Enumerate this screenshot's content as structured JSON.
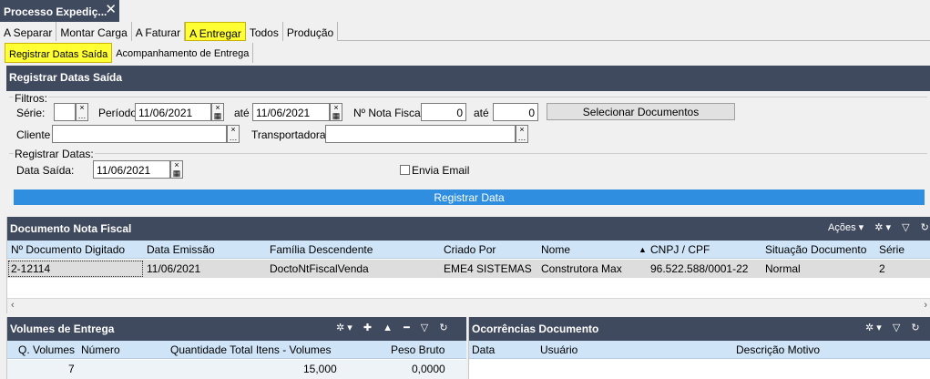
{
  "window": {
    "title": "Processo Expediç...",
    "close": "✕"
  },
  "tabs_main": [
    {
      "label": "A Separar"
    },
    {
      "label": "Montar Carga"
    },
    {
      "label": "A Faturar"
    },
    {
      "label": "A Entregar"
    },
    {
      "label": "Todos"
    },
    {
      "label": "Produção"
    }
  ],
  "tabs_sub": [
    {
      "label": "Registrar Datas Saída"
    },
    {
      "label": "Acompanhamento de Entrega"
    }
  ],
  "registrar": {
    "title": "Registrar Datas Saída",
    "filtros_label": "Filtros:",
    "serie_label": "Série:",
    "serie_value": "",
    "periodo_label": "Período",
    "periodo_de": "11/06/2021",
    "ate1_label": "até",
    "periodo_ate": "11/06/2021",
    "nota_label": "Nº Nota Fiscal",
    "nota_de": "0",
    "ate2_label": "até",
    "nota_ate": "0",
    "selecionar_label": "Selecionar Documentos",
    "cliente_label": "Cliente",
    "cliente_value": "",
    "transportadora_label": "Transportadora",
    "transportadora_value": "",
    "registrar_datas_label": "Registrar Datas:",
    "data_saida_label": "Data Saída:",
    "data_saida_value": "11/06/2021",
    "envia_email_label": "Envia Email",
    "envia_email_checked": false,
    "registrar_btn": "Registrar Data"
  },
  "documento": {
    "title": "Documento Nota Fiscal",
    "acoes": "Ações",
    "columns": [
      "Nº Documento Digitado",
      "Data Emissão",
      "Família Descendente",
      "Criado Por",
      "Nome",
      "CNPJ / CPF",
      "Situação Documento",
      "Série"
    ],
    "rows": [
      [
        "2-12114",
        "11/06/2021",
        "DoctoNtFiscalVenda",
        "EME4 SISTEMAS",
        "Construtora Max",
        "96.522.588/0001-22",
        "Normal",
        "2"
      ]
    ],
    "sort_column": "CNPJ / CPF"
  },
  "volumes": {
    "title": "Volumes de Entrega",
    "columns": [
      "Q. Volumes",
      "Número",
      "Quantidade Total Itens - Volumes",
      "Peso Bruto"
    ],
    "rows": [
      [
        "7",
        "",
        "15,000",
        "0,0000"
      ]
    ]
  },
  "ocorrencias": {
    "title": "Ocorrências Documento",
    "columns": [
      "Data",
      "Usuário",
      "Descrição Motivo"
    ]
  },
  "colors": {
    "header_bg": "#404a5e",
    "active_tab": "#ffff33",
    "grid_header": "#cfe4f7",
    "button_blue": "#2f8ee0"
  }
}
